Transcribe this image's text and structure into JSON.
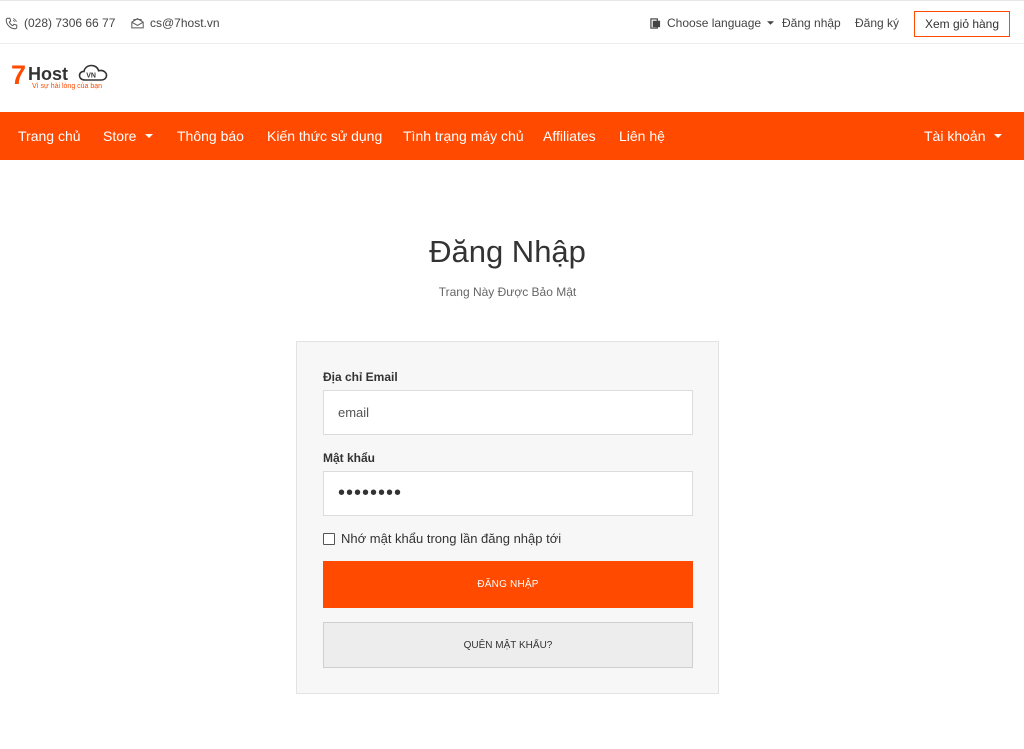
{
  "topbar": {
    "phone": "(028) 7306 66 77",
    "email": "cs@7host.vn",
    "language": "Choose language",
    "login": "Đăng nhập",
    "register": "Đăng ký",
    "cart": "Xem giỏ hàng"
  },
  "logo": {
    "number": "7",
    "name": "Host",
    "badge": "VN",
    "tagline": "Vì sự hài lòng của bạn"
  },
  "nav": {
    "items": [
      {
        "label": "Trang chủ"
      },
      {
        "label": "Store"
      },
      {
        "label": "Thông báo"
      },
      {
        "label": "Kiến thức sử dụng"
      },
      {
        "label": "Tình trạng máy chủ"
      },
      {
        "label": "Affiliates"
      },
      {
        "label": "Liên hệ"
      }
    ],
    "account": "Tài khoản"
  },
  "page": {
    "title": "Đăng Nhập",
    "subtitle": "Trang Này Được Bảo Mật"
  },
  "form": {
    "email_label": "Địa chỉ Email",
    "email_value": "email",
    "password_label": "Mật khẩu",
    "password_value": "••••••••",
    "remember_label": "Nhớ mật khẩu trong lần đăng nhập tới",
    "submit_label": "ĐĂNG NHẬP",
    "forgot_label": "QUÊN MẬT KHẨU?"
  },
  "colors": {
    "brand": "#ff4a00"
  },
  "icons": {
    "phone": "phone-icon",
    "email": "envelope-icon",
    "language": "language-flag-icon",
    "logo_cloud": "cloud-icon",
    "caret": "chevron-down-icon"
  }
}
